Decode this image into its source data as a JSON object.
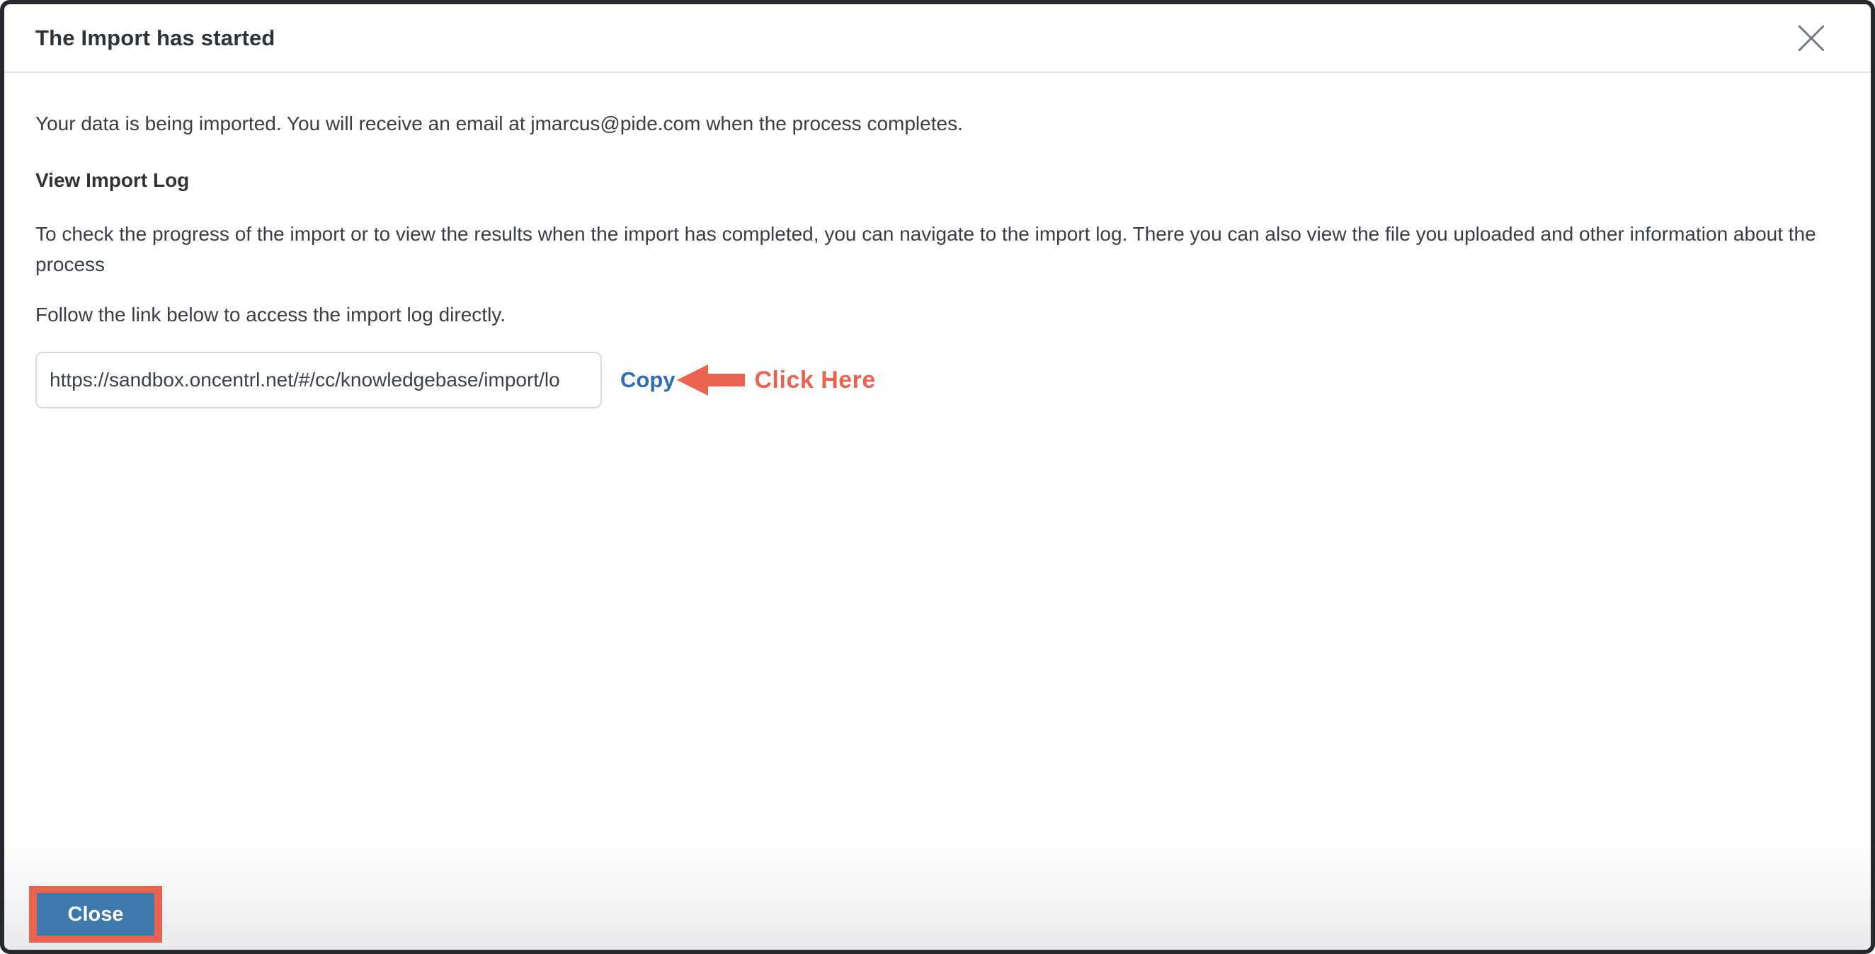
{
  "header": {
    "title": "The Import has started",
    "close_icon": "x-icon"
  },
  "body": {
    "intro": "Your data is being imported. You will receive an email at jmarcus@pide.com when the process completes.",
    "section_heading": "View Import Log",
    "section_paragraph": "To check the progress of the import or to view the results when the import has completed, you can navigate to the import log. There you can also view the file you uploaded and other information about the process",
    "follow_instruction": "Follow the link below to access the import log directly.",
    "import_log_url": "https://sandbox.oncentrl.net/#/cc/knowledgebase/import/lo",
    "copy_link_label": "Copy"
  },
  "annotations": {
    "click_here_label": "Click Here",
    "annotation_color": "#ea6350"
  },
  "footer": {
    "close_button_label": "Close"
  },
  "colors": {
    "link_blue": "#2e6db4",
    "button_blue": "#3d79ab",
    "annotation_red": "#ea6350",
    "text_dark": "#383e44",
    "window_border": "#25282d",
    "divider": "#e4e7ea"
  }
}
